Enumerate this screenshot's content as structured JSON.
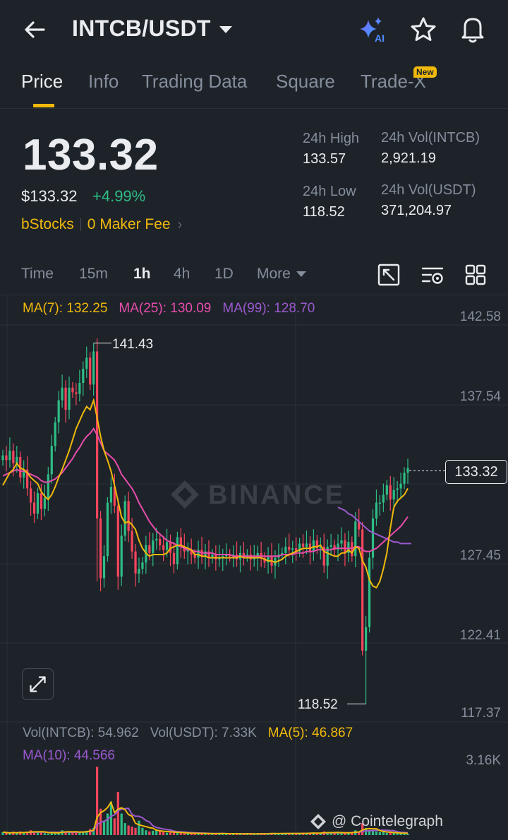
{
  "header": {
    "pair": "INTCB/USDT",
    "icons": [
      "back-arrow-icon",
      "ai-sparkle-icon",
      "star-icon",
      "bell-icon"
    ]
  },
  "tabs": [
    {
      "label": "Price",
      "active": true
    },
    {
      "label": "Info",
      "active": false
    },
    {
      "label": "Trading Data",
      "active": false
    },
    {
      "label": "Square",
      "active": false
    },
    {
      "label": "Trade-X",
      "active": false,
      "badge": "New"
    }
  ],
  "ticker": {
    "last_price": "133.32",
    "price_usd": "$133.32",
    "change": "+4.99%",
    "tag": "bStocks",
    "fee": "0 Maker Fee",
    "high_label": "24h High",
    "high_value": "133.57",
    "low_label": "24h Low",
    "low_value": "118.52",
    "vol_base_label": "24h Vol(INTCB)",
    "vol_base_value": "2,921.19",
    "vol_quote_label": "24h Vol(USDT)",
    "vol_quote_value": "371,204.97"
  },
  "timeframes": {
    "items": [
      "Time",
      "15m",
      "1h",
      "4h",
      "1D"
    ],
    "active": "1h",
    "more_label": "More"
  },
  "indicators": {
    "ma7": "MA(7): 132.25",
    "ma25": "MA(25): 130.09",
    "ma99": "MA(99): 128.70"
  },
  "chart_data": {
    "type": "candlestick",
    "interval": "1h",
    "y_ticks": [
      "142.58",
      "137.54",
      "127.45",
      "122.41",
      "117.37"
    ],
    "ylim": [
      117.37,
      142.58
    ],
    "current_price_label": "133.32",
    "high_marker": "141.43",
    "low_marker": "118.52",
    "watermark": "BINANCE",
    "colors": {
      "up": "#2ebd85",
      "down": "#f6465d",
      "ma7": "#f0b90b",
      "ma25": "#e84cac",
      "ma99": "#9b59d0",
      "vol_ma5": "#f0b90b",
      "vol_ma10": "#9b59d0"
    },
    "close": [
      134.3,
      134.0,
      134.6,
      133.8,
      134.2,
      132.9,
      133.4,
      132.2,
      131.3,
      130.6,
      131.9,
      130.9,
      131.6,
      133.1,
      134.9,
      136.4,
      137.8,
      138.6,
      137.2,
      138.6,
      138.3,
      138.2,
      138.9,
      139.8,
      140.5,
      138.8,
      140.9,
      130.3,
      126.5,
      127.9,
      131.3,
      132.3,
      131.1,
      126.6,
      129.2,
      131.4,
      129.5,
      128.2,
      126.8,
      127.1,
      127.5,
      128.6,
      128.1,
      128.9,
      129.0,
      128.6,
      128.3,
      128.8,
      128.1,
      127.4,
      129.1,
      128.5,
      128.2,
      128.3,
      128.0,
      127.8,
      128.3,
      127.9,
      128.2,
      127.8,
      128.0,
      127.7,
      127.8,
      127.9,
      128.0,
      127.9,
      128.0,
      127.7,
      128.1,
      127.9,
      128.0,
      127.7,
      127.8,
      128.1,
      127.8,
      127.5,
      127.9,
      127.3,
      127.8,
      128.0,
      128.1,
      128.5,
      128.3,
      128.4,
      128.2,
      128.7,
      128.5,
      128.7,
      128.2,
      128.9,
      128.4,
      128.5,
      127.3,
      128.5,
      128.6,
      128.3,
      128.7,
      128.9,
      128.1,
      128.8,
      127.9,
      130.1,
      129.6,
      121.9,
      123.4,
      127.8,
      130.3,
      131.3,
      131.3,
      131.8,
      132.4,
      131.5,
      132.1,
      132.2,
      132.5,
      133.2,
      133.5
    ],
    "ma7": [
      132.4,
      132.8,
      133.2,
      133.4,
      133.8,
      133.5,
      133.4,
      133.2,
      132.9,
      132.7,
      132.5,
      132.0,
      131.7,
      131.5,
      131.8,
      132.3,
      132.9,
      133.4,
      134.0,
      134.6,
      135.3,
      136.0,
      136.5,
      137.0,
      137.4,
      137.2,
      137.8,
      136.7,
      135.5,
      134.6,
      134.0,
      133.3,
      132.4,
      131.4,
      130.4,
      130.0,
      130.1,
      129.9,
      129.6,
      128.9,
      128.4,
      128.1,
      127.9,
      128.0,
      128.0,
      128.0,
      128.0,
      128.1,
      128.4,
      128.5,
      128.6,
      128.6,
      128.5,
      128.4,
      128.3,
      128.0,
      128.0,
      127.9,
      127.9,
      127.8,
      127.8,
      127.8,
      127.8,
      127.8,
      127.8,
      127.8,
      127.8,
      127.8,
      127.9,
      127.8,
      127.8,
      127.8,
      127.8,
      127.8,
      127.8,
      127.7,
      127.6,
      127.6,
      127.5,
      127.6,
      127.7,
      127.9,
      128.0,
      128.1,
      128.2,
      128.3,
      128.4,
      128.4,
      128.4,
      128.5,
      128.5,
      128.6,
      128.2,
      128.1,
      128.0,
      127.9,
      127.9,
      128.1,
      128.1,
      128.3,
      128.1,
      128.5,
      128.4,
      127.6,
      127.2,
      126.4,
      126.0,
      125.9,
      126.3,
      127.1,
      128.1,
      129.7,
      131.0,
      131.4,
      131.6,
      131.8,
      132.2
    ],
    "ma25": [
      133.0,
      133.1,
      133.2,
      133.3,
      133.4,
      133.3,
      133.3,
      133.2,
      133.1,
      133.0,
      132.9,
      132.7,
      132.6,
      132.6,
      132.7,
      132.8,
      133.0,
      133.2,
      133.5,
      133.8,
      134.1,
      134.5,
      134.8,
      135.2,
      135.5,
      135.7,
      136.0,
      135.6,
      135.1,
      134.6,
      134.4,
      134.2,
      134.0,
      133.6,
      133.1,
      132.8,
      132.5,
      132.2,
      131.8,
      131.3,
      130.9,
      130.5,
      130.1,
      129.8,
      129.5,
      129.3,
      129.1,
      128.9,
      128.8,
      128.7,
      128.6,
      128.5,
      128.4,
      128.3,
      128.3,
      128.2,
      128.2,
      128.1,
      128.1,
      128.1,
      128.1,
      128.0,
      128.0,
      128.0,
      128.0,
      128.0,
      127.9,
      127.9,
      127.9,
      127.9,
      127.9,
      127.9,
      127.9,
      127.9,
      127.9,
      127.9,
      127.9,
      127.9,
      127.9,
      127.9,
      128.0,
      128.0,
      128.0,
      128.0,
      128.1,
      128.1,
      128.1,
      128.2,
      128.2,
      128.2,
      128.3,
      128.3,
      128.3,
      128.3,
      128.3,
      128.4,
      128.4,
      128.4,
      128.4,
      128.4,
      128.4,
      128.5,
      128.5,
      128.3,
      128.2,
      128.2,
      128.3,
      128.4,
      128.6,
      128.8,
      129.0,
      129.2,
      129.4,
      129.6,
      129.8,
      130.1,
      130.4
    ],
    "ma99": [
      131.0,
      130.9,
      130.8,
      130.6,
      130.5,
      130.3,
      130.1,
      129.9,
      129.7,
      129.5,
      129.4,
      129.3,
      129.2,
      129.1,
      129.0,
      128.9,
      128.8,
      128.8,
      128.7,
      128.7,
      128.7,
      128.7
    ],
    "ma99_start_index": 96,
    "volume_panel": {
      "label_base": "Vol(INTCB): 54.962",
      "label_quote": "Vol(USDT): 7.33K",
      "ma5": "MA(5): 46.867",
      "ma10": "MA(10): 44.566",
      "max_label": "3.16K",
      "values": [
        120,
        90,
        60,
        140,
        80,
        150,
        90,
        110,
        200,
        130,
        150,
        100,
        80,
        60,
        110,
        120,
        90,
        200,
        150,
        130,
        90,
        140,
        110,
        160,
        180,
        250,
        300,
        2850,
        1100,
        600,
        900,
        1400,
        700,
        1800,
        900,
        500,
        400,
        350,
        300,
        600,
        300,
        200,
        150,
        180,
        200,
        150,
        120,
        100,
        110,
        150,
        90,
        80,
        70,
        60,
        90,
        80,
        70,
        60,
        50,
        70,
        60,
        50,
        80,
        60,
        50,
        40,
        60,
        70,
        50,
        40,
        60,
        50,
        40,
        60,
        70,
        50,
        60,
        80,
        70,
        50,
        60,
        80,
        70,
        60,
        50,
        80,
        90,
        70,
        100,
        90,
        60,
        80,
        150,
        120,
        90,
        80,
        110,
        100,
        90,
        80,
        120,
        200,
        150,
        500,
        300,
        200,
        160,
        150,
        120,
        130,
        90,
        100,
        80,
        70,
        60,
        100,
        50
      ]
    }
  },
  "watermark_text": "@ Cointelegraph"
}
